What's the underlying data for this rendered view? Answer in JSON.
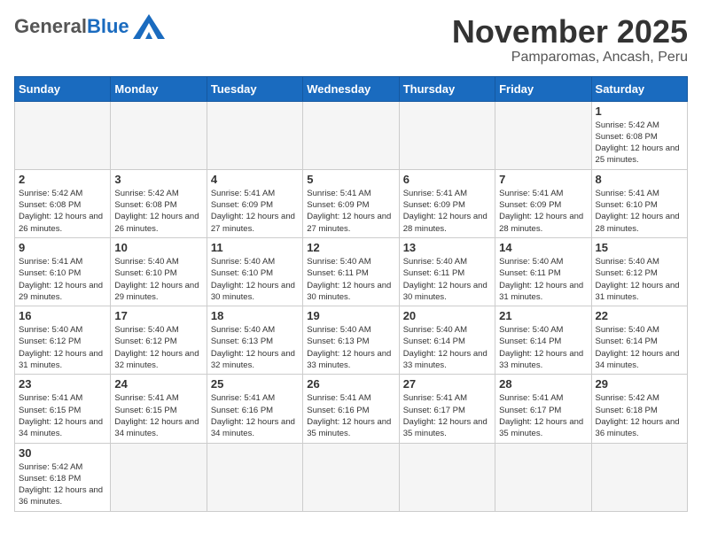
{
  "header": {
    "logo_general": "General",
    "logo_blue": "Blue",
    "month_title": "November 2025",
    "location": "Pamparomas, Ancash, Peru"
  },
  "weekdays": [
    "Sunday",
    "Monday",
    "Tuesday",
    "Wednesday",
    "Thursday",
    "Friday",
    "Saturday"
  ],
  "weeks": [
    [
      {
        "day": "",
        "info": ""
      },
      {
        "day": "",
        "info": ""
      },
      {
        "day": "",
        "info": ""
      },
      {
        "day": "",
        "info": ""
      },
      {
        "day": "",
        "info": ""
      },
      {
        "day": "",
        "info": ""
      },
      {
        "day": "1",
        "info": "Sunrise: 5:42 AM\nSunset: 6:08 PM\nDaylight: 12 hours and 25 minutes."
      }
    ],
    [
      {
        "day": "2",
        "info": "Sunrise: 5:42 AM\nSunset: 6:08 PM\nDaylight: 12 hours and 26 minutes."
      },
      {
        "day": "3",
        "info": "Sunrise: 5:42 AM\nSunset: 6:08 PM\nDaylight: 12 hours and 26 minutes."
      },
      {
        "day": "4",
        "info": "Sunrise: 5:41 AM\nSunset: 6:09 PM\nDaylight: 12 hours and 27 minutes."
      },
      {
        "day": "5",
        "info": "Sunrise: 5:41 AM\nSunset: 6:09 PM\nDaylight: 12 hours and 27 minutes."
      },
      {
        "day": "6",
        "info": "Sunrise: 5:41 AM\nSunset: 6:09 PM\nDaylight: 12 hours and 28 minutes."
      },
      {
        "day": "7",
        "info": "Sunrise: 5:41 AM\nSunset: 6:09 PM\nDaylight: 12 hours and 28 minutes."
      },
      {
        "day": "8",
        "info": "Sunrise: 5:41 AM\nSunset: 6:10 PM\nDaylight: 12 hours and 28 minutes."
      }
    ],
    [
      {
        "day": "9",
        "info": "Sunrise: 5:41 AM\nSunset: 6:10 PM\nDaylight: 12 hours and 29 minutes."
      },
      {
        "day": "10",
        "info": "Sunrise: 5:40 AM\nSunset: 6:10 PM\nDaylight: 12 hours and 29 minutes."
      },
      {
        "day": "11",
        "info": "Sunrise: 5:40 AM\nSunset: 6:10 PM\nDaylight: 12 hours and 30 minutes."
      },
      {
        "day": "12",
        "info": "Sunrise: 5:40 AM\nSunset: 6:11 PM\nDaylight: 12 hours and 30 minutes."
      },
      {
        "day": "13",
        "info": "Sunrise: 5:40 AM\nSunset: 6:11 PM\nDaylight: 12 hours and 30 minutes."
      },
      {
        "day": "14",
        "info": "Sunrise: 5:40 AM\nSunset: 6:11 PM\nDaylight: 12 hours and 31 minutes."
      },
      {
        "day": "15",
        "info": "Sunrise: 5:40 AM\nSunset: 6:12 PM\nDaylight: 12 hours and 31 minutes."
      }
    ],
    [
      {
        "day": "16",
        "info": "Sunrise: 5:40 AM\nSunset: 6:12 PM\nDaylight: 12 hours and 31 minutes."
      },
      {
        "day": "17",
        "info": "Sunrise: 5:40 AM\nSunset: 6:12 PM\nDaylight: 12 hours and 32 minutes."
      },
      {
        "day": "18",
        "info": "Sunrise: 5:40 AM\nSunset: 6:13 PM\nDaylight: 12 hours and 32 minutes."
      },
      {
        "day": "19",
        "info": "Sunrise: 5:40 AM\nSunset: 6:13 PM\nDaylight: 12 hours and 33 minutes."
      },
      {
        "day": "20",
        "info": "Sunrise: 5:40 AM\nSunset: 6:14 PM\nDaylight: 12 hours and 33 minutes."
      },
      {
        "day": "21",
        "info": "Sunrise: 5:40 AM\nSunset: 6:14 PM\nDaylight: 12 hours and 33 minutes."
      },
      {
        "day": "22",
        "info": "Sunrise: 5:40 AM\nSunset: 6:14 PM\nDaylight: 12 hours and 34 minutes."
      }
    ],
    [
      {
        "day": "23",
        "info": "Sunrise: 5:41 AM\nSunset: 6:15 PM\nDaylight: 12 hours and 34 minutes."
      },
      {
        "day": "24",
        "info": "Sunrise: 5:41 AM\nSunset: 6:15 PM\nDaylight: 12 hours and 34 minutes."
      },
      {
        "day": "25",
        "info": "Sunrise: 5:41 AM\nSunset: 6:16 PM\nDaylight: 12 hours and 34 minutes."
      },
      {
        "day": "26",
        "info": "Sunrise: 5:41 AM\nSunset: 6:16 PM\nDaylight: 12 hours and 35 minutes."
      },
      {
        "day": "27",
        "info": "Sunrise: 5:41 AM\nSunset: 6:17 PM\nDaylight: 12 hours and 35 minutes."
      },
      {
        "day": "28",
        "info": "Sunrise: 5:41 AM\nSunset: 6:17 PM\nDaylight: 12 hours and 35 minutes."
      },
      {
        "day": "29",
        "info": "Sunrise: 5:42 AM\nSunset: 6:18 PM\nDaylight: 12 hours and 36 minutes."
      }
    ],
    [
      {
        "day": "30",
        "info": "Sunrise: 5:42 AM\nSunset: 6:18 PM\nDaylight: 12 hours and 36 minutes."
      },
      {
        "day": "",
        "info": ""
      },
      {
        "day": "",
        "info": ""
      },
      {
        "day": "",
        "info": ""
      },
      {
        "day": "",
        "info": ""
      },
      {
        "day": "",
        "info": ""
      },
      {
        "day": "",
        "info": ""
      }
    ]
  ]
}
